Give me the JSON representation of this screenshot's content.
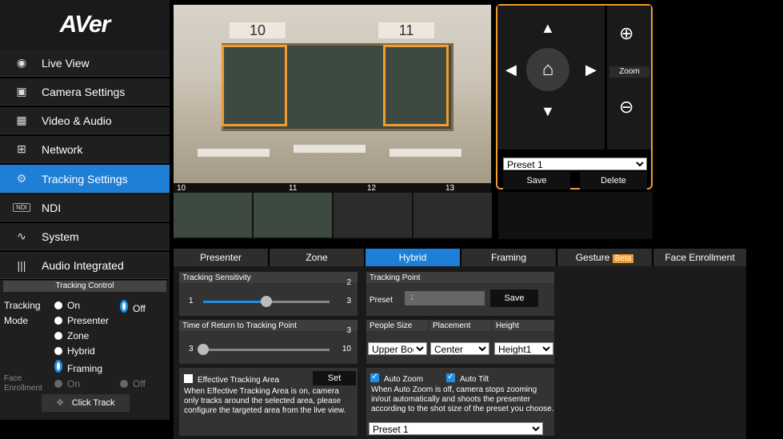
{
  "brand": "AVer",
  "nav": [
    {
      "label": "Live View",
      "icon": "eye-icon",
      "glyph": "◉"
    },
    {
      "label": "Camera Settings",
      "icon": "image-icon",
      "glyph": "▣"
    },
    {
      "label": "Video & Audio",
      "icon": "video-audio-icon",
      "glyph": "▦"
    },
    {
      "label": "Network",
      "icon": "network-icon",
      "glyph": "⊞"
    },
    {
      "label": "Tracking Settings",
      "icon": "tracking-settings-icon",
      "glyph": "⚙"
    },
    {
      "label": "NDI",
      "icon": "ndi-icon",
      "glyph": "NDI"
    },
    {
      "label": "System",
      "icon": "system-icon",
      "glyph": "∿"
    },
    {
      "label": "Audio Integrated",
      "icon": "audio-icon",
      "glyph": "|||"
    }
  ],
  "tracking_control": {
    "title": "Tracking Control",
    "tracking_label": "Tracking",
    "on": "On",
    "off": "Off",
    "mode_label": "Mode",
    "modes": [
      "Presenter",
      "Zone",
      "Hybrid",
      "Framing"
    ],
    "face_label": "Face Enrollment",
    "face_on": "On",
    "face_off": "Off",
    "click_track": "Click Track"
  },
  "video": {
    "zone_left": "10",
    "zone_right": "11"
  },
  "thumbs": [
    "10",
    "11",
    "12",
    "13"
  ],
  "ptz": {
    "zoom_label": "Zoom",
    "preset_value": "Preset 1",
    "save": "Save",
    "delete": "Delete"
  },
  "tabs": [
    "Presenter",
    "Zone",
    "Hybrid",
    "Framing",
    "Gesture",
    "Face Enrollment"
  ],
  "gesture_badge": "Beta",
  "sensitivity": {
    "title": "Tracking Sensitivity",
    "value": "2",
    "min": "1",
    "max": "3",
    "level": 0.5
  },
  "return": {
    "title": "Time of Return to Tracking Point",
    "value": "3",
    "min": "3",
    "max": "10",
    "level": 0
  },
  "tracking_point": {
    "title": "Tracking Point",
    "preset_label": "Preset",
    "preset_value": "1",
    "save": "Save"
  },
  "people": {
    "size_label": "People Size",
    "placement_label": "Placement",
    "height_label": "Height",
    "size": "Upper Body",
    "placement": "Center",
    "height": "Height1"
  },
  "area": {
    "label": "Effective Tracking Area",
    "set": "Set",
    "desc": "When Effective Tracking Area is on, camera only tracks around the selected area, please configure the targeted area from the live view."
  },
  "zoom": {
    "auto_zoom": "Auto Zoom",
    "auto_tilt": "Auto Tilt",
    "desc": "When Auto Zoom is off, camera stops zooming in/out automatically and shoots the presenter according to the shot size of the preset you choose.",
    "preset": "Preset 1"
  },
  "colors": {
    "accent": "#1d7fd6",
    "highlight": "#f29a2e"
  }
}
